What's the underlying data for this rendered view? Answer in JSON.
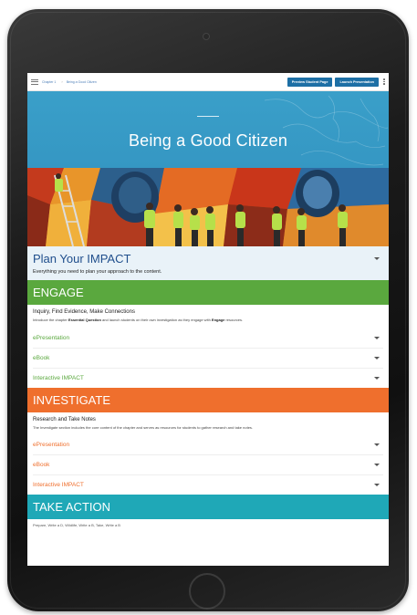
{
  "topbar": {
    "breadcrumb": [
      "Chapter 1",
      "Being a Good Citizen"
    ],
    "buttons": [
      "Preview Student Page",
      "Launch Presentation"
    ]
  },
  "hero": {
    "title": "Being a Good Citizen"
  },
  "plan": {
    "title": "Plan Your IMPACT",
    "subtitle": "Everything you need to plan your approach to the content."
  },
  "engage": {
    "title": "ENGAGE",
    "heading": "Inquiry, Find Evidence, Make Connections",
    "description": {
      "before": "Introduce the chapter ",
      "bold1": "Essential Question",
      "middle": " and launch students on their own investigation as they engage with ",
      "bold2": "Engage",
      "after": " resources."
    },
    "items": [
      "ePresentation",
      "eBook",
      "Interactive IMPACT"
    ]
  },
  "investigate": {
    "title": "INVESTIGATE",
    "heading": "Research and Take Notes",
    "description": "The Investigate section includes the core content of the chapter and serves as resources for students to gather research and take notes.",
    "items": [
      "ePresentation",
      "eBook",
      "Interactive IMPACT"
    ]
  },
  "take_action": {
    "title": "TAKE ACTION",
    "line": "Prepare, Write a D, Wildlife, Write a B, Take, Write a B"
  },
  "colors": {
    "engage": "#5aa83e",
    "investigate": "#ef6f2d",
    "take_action": "#1fa8b7",
    "plan_title": "#1f4e8c",
    "hero": "#3a9fc9"
  }
}
